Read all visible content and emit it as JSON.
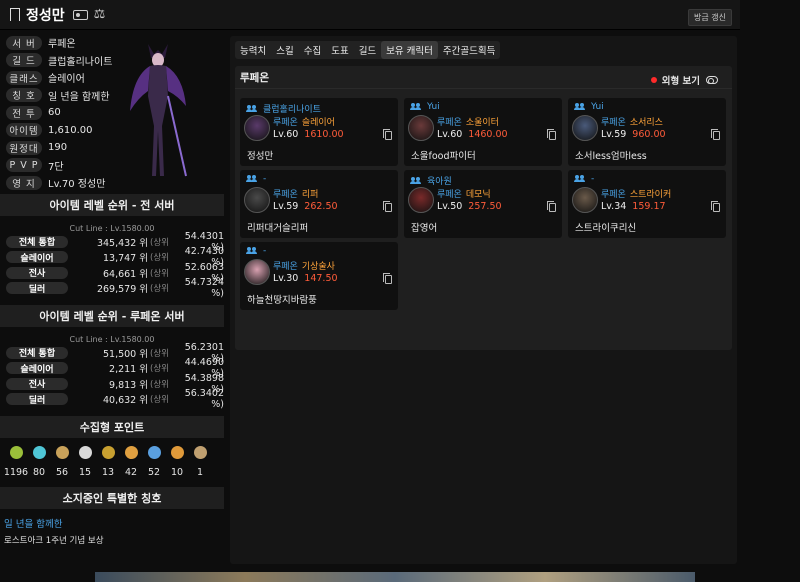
{
  "header": {
    "name": "정성만",
    "refresh_label": "방금 갱신"
  },
  "profile": {
    "rows": [
      {
        "label": "서 버",
        "value": "루페온"
      },
      {
        "label": "길 드",
        "value": "클럽홀리나이트"
      },
      {
        "label": "클래스",
        "value": "슬레이어"
      },
      {
        "label": "칭 호",
        "value": "일 년을 함께한"
      },
      {
        "label": "전 투",
        "value": "60"
      },
      {
        "label": "아이템",
        "value": "1,610.00"
      },
      {
        "label": "원정대",
        "value": "190"
      },
      {
        "label": "P V P",
        "value": "7단"
      },
      {
        "label": "영 지",
        "value": "Lv.70 정성만"
      }
    ]
  },
  "rank_all": {
    "title": "아이템 레벨 순위 - 전 서버",
    "cutline": "Cut Line : Lv.1580.00",
    "sang": "(상위",
    "rows": [
      {
        "label": "전체 통합",
        "value": "345,432 위",
        "pct": "54.4301 %)"
      },
      {
        "label": "슬레이어",
        "value": "13,747 위",
        "pct": "42.7430 %)"
      },
      {
        "label": "전사",
        "value": "64,661 위",
        "pct": "52.6063 %)"
      },
      {
        "label": "딜러",
        "value": "269,579 위",
        "pct": "54.7324 %)"
      }
    ]
  },
  "rank_server": {
    "title": "아이템 레벨 순위 - 루페온 서버",
    "cutline": "Cut Line : Lv.1580.00",
    "sang": "(상위",
    "rows": [
      {
        "label": "전체 통합",
        "value": "51,500 위",
        "pct": "56.2301 %)"
      },
      {
        "label": "슬레이어",
        "value": "2,211 위",
        "pct": "44.4690 %)"
      },
      {
        "label": "전사",
        "value": "9,813 위",
        "pct": "54.3898 %)"
      },
      {
        "label": "딜러",
        "value": "40,632 위",
        "pct": "56.3402 %)"
      }
    ]
  },
  "collect": {
    "title": "수집형 포인트",
    "items": [
      {
        "icon": "mokoko-seed-icon",
        "color": "#9bbf3a",
        "value": "1196"
      },
      {
        "icon": "island-heart-icon",
        "color": "#4fc6d6",
        "value": "80"
      },
      {
        "icon": "great-art-icon",
        "color": "#c9a25a",
        "value": "56"
      },
      {
        "icon": "giant-heart-icon",
        "color": "#d8d8d8",
        "value": "15"
      },
      {
        "icon": "ignea-token-icon",
        "color": "#c8a030",
        "value": "13"
      },
      {
        "icon": "adventure-tome-icon",
        "color": "#e0a040",
        "value": "42"
      },
      {
        "icon": "world-tree-leaf-icon",
        "color": "#5aa0e0",
        "value": "52"
      },
      {
        "icon": "orpheus-star-icon",
        "color": "#e09a3a",
        "value": "10"
      },
      {
        "icon": "sea-bounty-icon",
        "color": "#c0a070",
        "value": "1"
      }
    ]
  },
  "titles": {
    "heading": "소지중인 특별한 칭호",
    "name": "일 년을 함께한",
    "desc": "로스트아크 1주년 기념 보상"
  },
  "tabs": [
    "능력치",
    "스킬",
    "수집",
    "도표",
    "길드",
    "보유 캐릭터",
    "주간골드획득"
  ],
  "roster": {
    "server": "루페온",
    "outfit_label": "외형 보기",
    "cards": [
      {
        "guild": "클럽홀리나이트",
        "server": "루페온",
        "cls": "슬레이어",
        "lv": "Lv.60",
        "ilvl": "1610.00",
        "nick": "정성만",
        "avatar": "#5a3a6a"
      },
      {
        "guild": "Yui",
        "server": "루페온",
        "cls": "소울이터",
        "lv": "Lv.60",
        "ilvl": "1460.00",
        "nick": "소울food파이터",
        "avatar": "#6a3a3a"
      },
      {
        "guild": "Yui",
        "server": "루페온",
        "cls": "소서리스",
        "lv": "Lv.59",
        "ilvl": "960.00",
        "nick": "소서less엄마less",
        "avatar": "#4a5a7a"
      },
      {
        "guild": "-",
        "server": "루페온",
        "cls": "리퍼",
        "lv": "Lv.59",
        "ilvl": "262.50",
        "nick": "리퍼대거슬리퍼",
        "avatar": "#4a4a4a"
      },
      {
        "guild": "육아원",
        "server": "루페온",
        "cls": "데모닉",
        "lv": "Lv.50",
        "ilvl": "257.50",
        "nick": "잡영어",
        "avatar": "#7a2a2a"
      },
      {
        "guild": "-",
        "server": "루페온",
        "cls": "스트라이커",
        "lv": "Lv.34",
        "ilvl": "159.17",
        "nick": "스트라이쿠리신",
        "avatar": "#6a5a4a"
      },
      {
        "guild": "-",
        "server": "루페온",
        "cls": "기상술사",
        "lv": "Lv.30",
        "ilvl": "147.50",
        "nick": "하늘천땅지바람풍",
        "avatar": "#d8a0b0"
      }
    ]
  }
}
